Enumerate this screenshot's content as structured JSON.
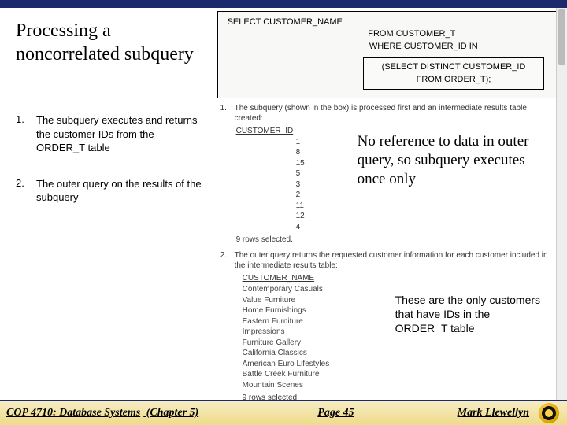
{
  "title": "Processing a noncorrelated subquery",
  "steps": [
    {
      "num": "1.",
      "text": "The subquery executes and returns the customer IDs from the ORDER_T table"
    },
    {
      "num": "2.",
      "text": "The outer query on the results of the subquery"
    }
  ],
  "sql": {
    "line1": "SELECT CUSTOMER_NAME",
    "line2": "FROM CUSTOMER_T",
    "line3": "WHERE CUSTOMER_ID IN",
    "inner1": "(SELECT DISTINCT CUSTOMER_ID",
    "inner2": "FROM ORDER_T);"
  },
  "result1": {
    "num": "1.",
    "caption": "The subquery (shown in the box) is processed first and an intermediate results table created:",
    "col": "CUSTOMER_ID",
    "ids": [
      "1",
      "8",
      "15",
      "5",
      "3",
      "2",
      "11",
      "12",
      "4"
    ],
    "rows_text": "9 rows selected."
  },
  "result2": {
    "num": "2.",
    "caption": "The outer query returns the requested customer information for each customer included in the intermediate results table:",
    "col": "CUSTOMER_NAME",
    "names": [
      "Contemporary Casuals",
      "Value Furniture",
      "Home Furnishings",
      "Eastern Furniture",
      "Impressions",
      "Furniture Gallery",
      "California Classics",
      "American Euro Lifestyles",
      "Battle Creek Furniture",
      "Mountain Scenes"
    ],
    "rows_text": "9 rows selected."
  },
  "callout1": "No reference to data in outer query, so subquery executes once only",
  "callout2": "These are the only customers that have IDs in the ORDER_T table",
  "footer": {
    "course": "COP 4710: Database Systems",
    "chapter": "(Chapter 5)",
    "page": "Page 45",
    "author": "Mark Llewellyn"
  }
}
